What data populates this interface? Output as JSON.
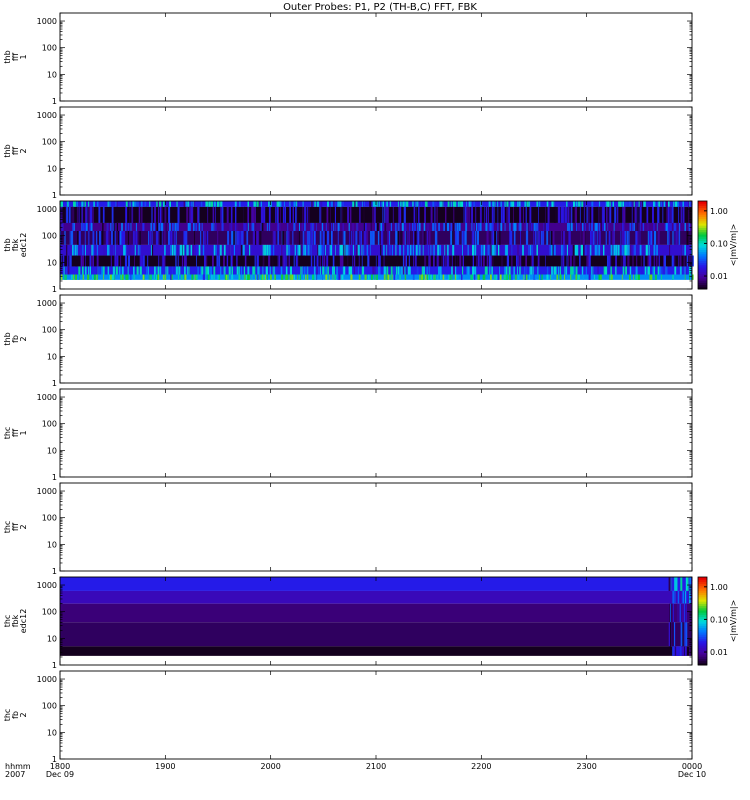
{
  "title": "Outer Probes: P1, P2 (TH-B,C) FFT, FBK",
  "chart_data": {
    "type": "heatmap",
    "title": "Outer Probes: P1, P2 (TH-B,C) FFT, FBK",
    "x": {
      "label_lines": [
        "hhmm",
        "2007"
      ],
      "ticks": [
        "1800",
        "1900",
        "2000",
        "2100",
        "2200",
        "2300",
        "0000"
      ],
      "date_labels": [
        "Dec 09",
        "Dec 10"
      ],
      "range": [
        "2007-12-09 18:00",
        "2007-12-10 00:00"
      ]
    },
    "y_scale": "log",
    "y_ticks": [
      "1",
      "10",
      "100",
      "1000"
    ],
    "ylim": [
      1,
      2000
    ],
    "colorbar": {
      "scale": "log",
      "ticks": [
        "1.00",
        "0.10",
        "0.01"
      ],
      "label": "<|mV/m|>",
      "range": [
        0.004,
        2.0
      ]
    },
    "panels": [
      {
        "ylabel": [
          "thb",
          "fff",
          "1"
        ],
        "has_data": false
      },
      {
        "ylabel": [
          "thb",
          "fff",
          "2"
        ],
        "has_data": false
      },
      {
        "ylabel": [
          "thb",
          "fbk",
          "edc12"
        ],
        "has_data": true,
        "bands_hz": [
          {
            "range": [
              1200,
              2000
            ],
            "level": 0.02
          },
          {
            "range": [
              300,
              1200
            ],
            "level": 0.004
          },
          {
            "range": [
              150,
              300
            ],
            "level": 0.008
          },
          {
            "range": [
              45,
              150
            ],
            "level": 0.006
          },
          {
            "range": [
              18,
              45
            ],
            "level": 0.015
          },
          {
            "range": [
              7,
              18
            ],
            "level": 0.004
          },
          {
            "range": [
              3.5,
              7
            ],
            "level": 0.02
          },
          {
            "range": [
              2.2,
              3.5
            ],
            "level": 0.05
          }
        ]
      },
      {
        "ylabel": [
          "thb",
          "fb",
          "2"
        ],
        "has_data": false
      },
      {
        "ylabel": [
          "thc",
          "fff",
          "1"
        ],
        "has_data": false
      },
      {
        "ylabel": [
          "thc",
          "fff",
          "2"
        ],
        "has_data": false
      },
      {
        "ylabel": [
          "thc",
          "fbk",
          "edc12"
        ],
        "has_data": true,
        "bands_hz": [
          {
            "range": [
              600,
              2000
            ],
            "level": 0.02
          },
          {
            "range": [
              200,
              600
            ],
            "level": 0.012
          },
          {
            "range": [
              40,
              200
            ],
            "level": 0.007
          },
          {
            "range": [
              5,
              40
            ],
            "level": 0.006
          },
          {
            "range": [
              2.2,
              5
            ],
            "level": 0.004
          }
        ]
      },
      {
        "ylabel": [
          "thc",
          "fb",
          "2"
        ],
        "has_data": false
      }
    ]
  }
}
